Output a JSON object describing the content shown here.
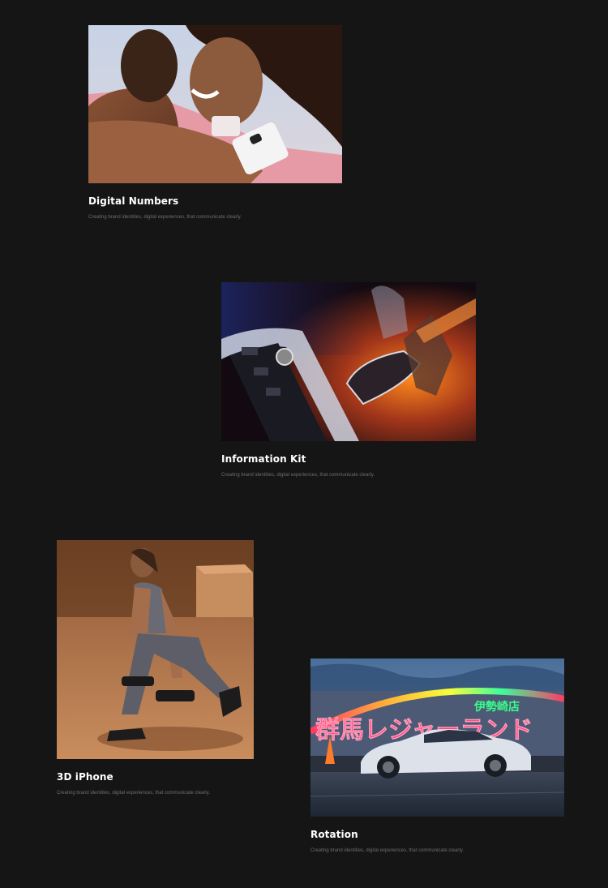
{
  "projects": [
    {
      "image": "hugging-woman-with-phone-photo",
      "title": "Digital Numbers",
      "description": "Creating brand identities, digital experiences, that communicate clearly."
    },
    {
      "image": "car-gear-shifter-photo",
      "title": "Information Kit",
      "description": "Creating brand identities, digital experiences, that communicate clearly."
    },
    {
      "image": "woman-lunge-dumbbells-photo",
      "title": "3D iPhone",
      "description": "Creating brand identities, digital experiences, that communicate clearly."
    },
    {
      "image": "white-car-neon-sign-photo",
      "title": "Rotation",
      "description": "Creating brand identities, digital experiences, that communicate clearly.",
      "neon_sign_text": "群馬レジャーランド",
      "neon_sign_small_text": "伊勢崎店"
    }
  ]
}
